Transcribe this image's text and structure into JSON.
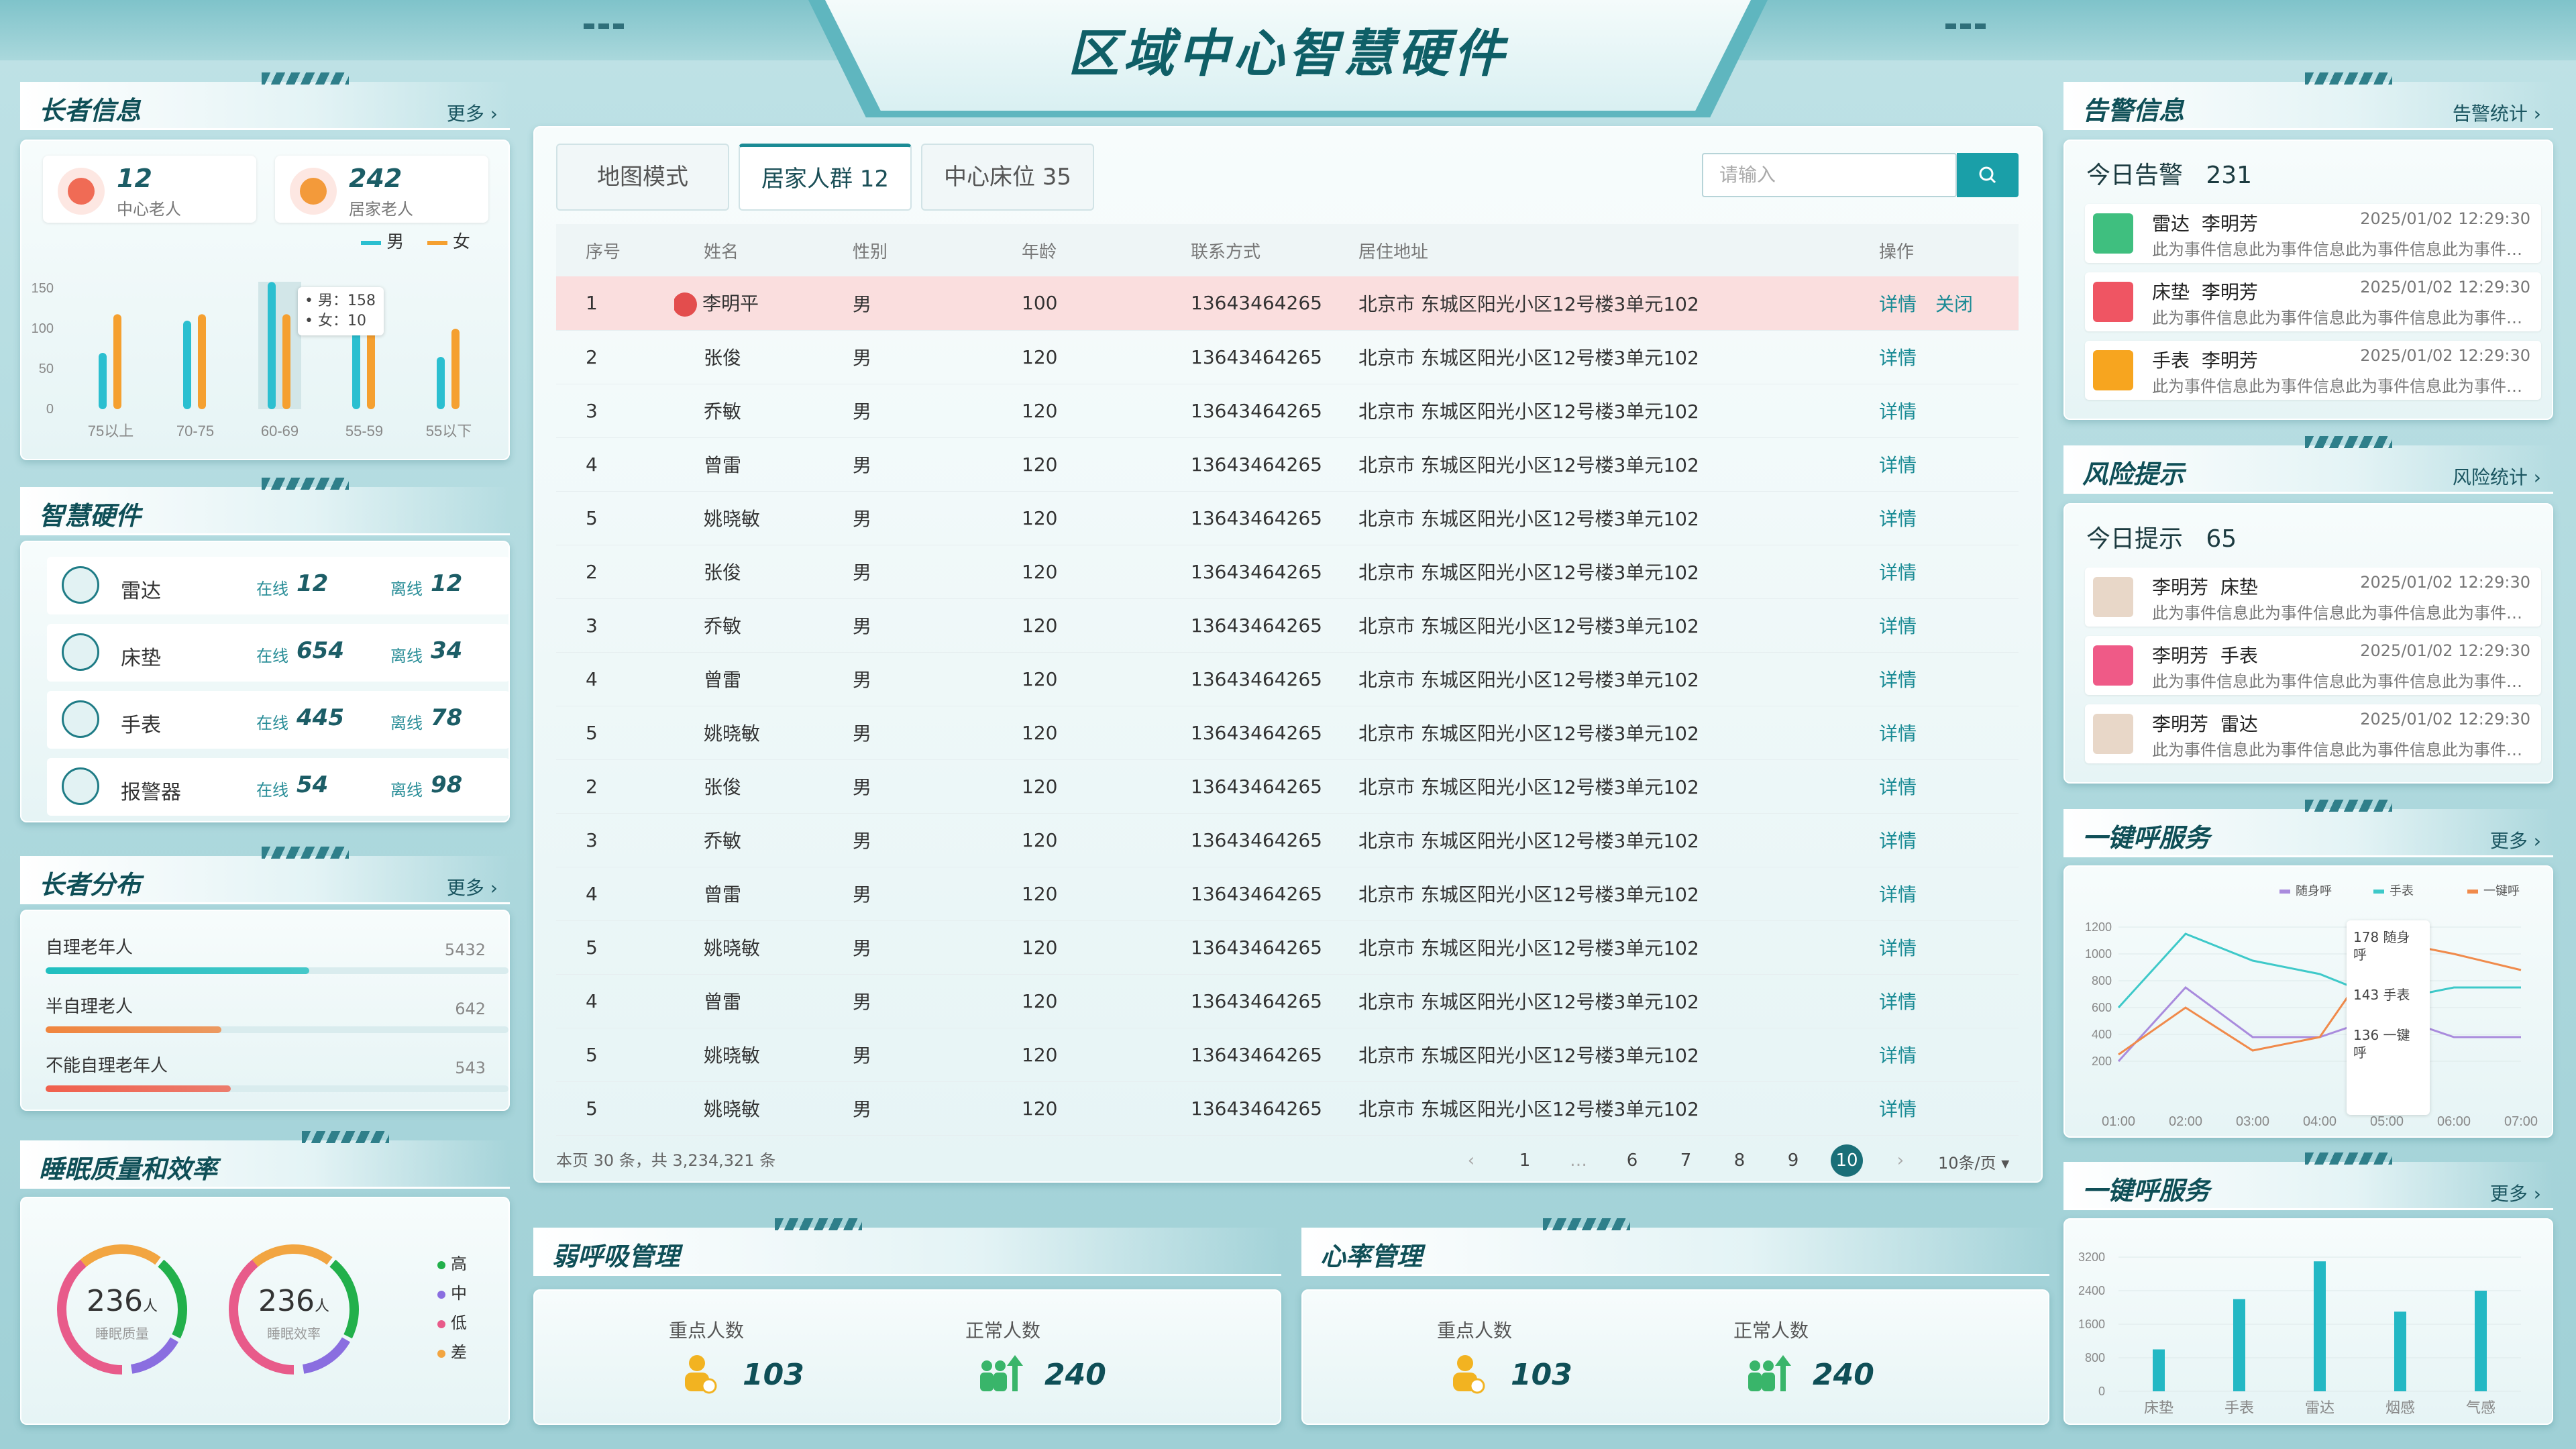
{
  "header": {
    "title": "区域中心智慧硬件"
  },
  "elder_info": {
    "title": "长者信息",
    "more": "更多 ›",
    "center_count": "12",
    "center_label": "中心老人",
    "home_count": "242",
    "home_label": "居家老人",
    "legend_male": "男",
    "legend_female": "女",
    "tooltip_male": "• 男：158",
    "tooltip_female": "• 女：10",
    "colors": {
      "male": "#2bbfd0",
      "female": "#f5a030"
    }
  },
  "chart_data": [
    {
      "type": "bar",
      "categories": [
        "75以上",
        "70-75",
        "60-69",
        "55-59",
        "55以下"
      ],
      "series": [
        {
          "name": "男",
          "values": [
            70,
            110,
            158,
            150,
            65
          ]
        },
        {
          "name": "女",
          "values": [
            118,
            118,
            118,
            118,
            100
          ]
        }
      ],
      "ylim": [
        0,
        150
      ],
      "yticks": [
        "0",
        "50",
        "100",
        "150"
      ]
    },
    {
      "type": "line",
      "x": [
        "01:00",
        "02:00",
        "03:00",
        "04:00",
        "05:00",
        "06:00",
        "07:00"
      ],
      "series": [
        {
          "name": "随身呼",
          "values": [
            200,
            750,
            380,
            380,
            550,
            380,
            380
          ]
        },
        {
          "name": "手表",
          "values": [
            600,
            1150,
            950,
            850,
            650,
            750,
            750
          ]
        },
        {
          "name": "一键呼",
          "values": [
            250,
            600,
            280,
            380,
            1100,
            1000,
            880
          ]
        }
      ],
      "ylim": [
        0,
        1200
      ],
      "yticks": [
        "200",
        "400",
        "600",
        "800",
        "1000",
        "1200"
      ],
      "tooltip": [
        "178 随身呼",
        "143 手表",
        "136 一键呼"
      ]
    },
    {
      "type": "bar",
      "categories": [
        "床垫",
        "手表",
        "雷达",
        "烟感",
        "气感"
      ],
      "values": [
        1000,
        2200,
        3100,
        1900,
        2400
      ],
      "ylim": [
        0,
        3200
      ],
      "yticks": [
        "0",
        "800",
        "1600",
        "2400",
        "3200"
      ]
    }
  ],
  "hardware": {
    "title": "智慧硬件",
    "online_label": "在线",
    "offline_label": "离线",
    "items": [
      {
        "name": "雷达",
        "online": "12",
        "offline": "12"
      },
      {
        "name": "床垫",
        "online": "654",
        "offline": "34"
      },
      {
        "name": "手表",
        "online": "445",
        "offline": "78"
      },
      {
        "name": "报警器",
        "online": "54",
        "offline": "98"
      }
    ]
  },
  "distribution": {
    "title": "长者分布",
    "more": "更多 ›",
    "items": [
      {
        "label": "自理老年人",
        "value": "5432",
        "fraction": 0.57,
        "color": "#20bfc0"
      },
      {
        "label": "半自理老人",
        "value": "642",
        "fraction": 0.38,
        "color": "#f0853e"
      },
      {
        "label": "不能自理老年人",
        "value": "543",
        "fraction": 0.4,
        "color": "#f0604d"
      }
    ]
  },
  "sleep": {
    "title": "睡眠质量和效率",
    "quality_value": "236",
    "quality_unit": "人",
    "quality_label": "睡眠质量",
    "efficiency_value": "236",
    "efficiency_unit": "人",
    "efficiency_label": "睡眠效率",
    "legend": [
      {
        "label": "高",
        "color": "#22b04b"
      },
      {
        "label": "中",
        "color": "#8a6ee0"
      },
      {
        "label": "低",
        "color": "#e85b8a"
      },
      {
        "label": "差",
        "color": "#f2a541"
      }
    ]
  },
  "main": {
    "tabs": [
      {
        "label": "地图模式"
      },
      {
        "label": "居家人群 12"
      },
      {
        "label": "中心床位 35"
      }
    ],
    "search_placeholder": "请输入",
    "columns": [
      "序号",
      "姓名",
      "性别",
      "年龄",
      "联系方式",
      "居住地址",
      "操作"
    ],
    "detail_label": "详情",
    "close_label": "关闭",
    "rows": [
      {
        "no": "1",
        "name": "李明平",
        "gender": "男",
        "age": "100",
        "phone": "13643464265",
        "addr": "北京市 东城区阳光小区12号楼3单元102"
      },
      {
        "no": "2",
        "name": "张俊",
        "gender": "男",
        "age": "120",
        "phone": "13643464265",
        "addr": "北京市 东城区阳光小区12号楼3单元102"
      },
      {
        "no": "3",
        "name": "乔敏",
        "gender": "男",
        "age": "120",
        "phone": "13643464265",
        "addr": "北京市 东城区阳光小区12号楼3单元102"
      },
      {
        "no": "4",
        "name": "曾雷",
        "gender": "男",
        "age": "120",
        "phone": "13643464265",
        "addr": "北京市 东城区阳光小区12号楼3单元102"
      },
      {
        "no": "5",
        "name": "姚晓敏",
        "gender": "男",
        "age": "120",
        "phone": "13643464265",
        "addr": "北京市 东城区阳光小区12号楼3单元102"
      },
      {
        "no": "2",
        "name": "张俊",
        "gender": "男",
        "age": "120",
        "phone": "13643464265",
        "addr": "北京市 东城区阳光小区12号楼3单元102"
      },
      {
        "no": "3",
        "name": "乔敏",
        "gender": "男",
        "age": "120",
        "phone": "13643464265",
        "addr": "北京市 东城区阳光小区12号楼3单元102"
      },
      {
        "no": "4",
        "name": "曾雷",
        "gender": "男",
        "age": "120",
        "phone": "13643464265",
        "addr": "北京市 东城区阳光小区12号楼3单元102"
      },
      {
        "no": "5",
        "name": "姚晓敏",
        "gender": "男",
        "age": "120",
        "phone": "13643464265",
        "addr": "北京市 东城区阳光小区12号楼3单元102"
      },
      {
        "no": "2",
        "name": "张俊",
        "gender": "男",
        "age": "120",
        "phone": "13643464265",
        "addr": "北京市 东城区阳光小区12号楼3单元102"
      },
      {
        "no": "3",
        "name": "乔敏",
        "gender": "男",
        "age": "120",
        "phone": "13643464265",
        "addr": "北京市 东城区阳光小区12号楼3单元102"
      },
      {
        "no": "4",
        "name": "曾雷",
        "gender": "男",
        "age": "120",
        "phone": "13643464265",
        "addr": "北京市 东城区阳光小区12号楼3单元102"
      },
      {
        "no": "5",
        "name": "姚晓敏",
        "gender": "男",
        "age": "120",
        "phone": "13643464265",
        "addr": "北京市 东城区阳光小区12号楼3单元102"
      },
      {
        "no": "4",
        "name": "曾雷",
        "gender": "男",
        "age": "120",
        "phone": "13643464265",
        "addr": "北京市 东城区阳光小区12号楼3单元102"
      },
      {
        "no": "5",
        "name": "姚晓敏",
        "gender": "男",
        "age": "120",
        "phone": "13643464265",
        "addr": "北京市 东城区阳光小区12号楼3单元102"
      },
      {
        "no": "5",
        "name": "姚晓敏",
        "gender": "男",
        "age": "120",
        "phone": "13643464265",
        "addr": "北京市 东城区阳光小区12号楼3单元102"
      }
    ],
    "pager": {
      "info": "本页 30 条，共 3,234,321 条",
      "pages": [
        "1",
        "…",
        "6",
        "7",
        "8",
        "9",
        "10"
      ],
      "current": "10",
      "prev": "‹",
      "next": "›",
      "size": "10条/页 ▾"
    }
  },
  "weak_breath": {
    "title": "弱呼吸管理",
    "key_label": "重点人数",
    "key_value": "103",
    "normal_label": "正常人数",
    "normal_value": "240"
  },
  "heart_rate": {
    "title": "心率管理",
    "key_label": "重点人数",
    "key_value": "103",
    "normal_label": "正常人数",
    "normal_value": "240"
  },
  "alarm": {
    "title": "告警信息",
    "more": "告警统计 ›",
    "today_label": "今日告警",
    "today_value": "231",
    "items": [
      {
        "device": "雷达",
        "name": "李明芳",
        "time": "2025/01/02 12:29:30",
        "desc": "此为事件信息此为事件信息此为事件信息此为事件信息",
        "color": "#3fbf7f"
      },
      {
        "device": "床垫",
        "name": "李明芳",
        "time": "2025/01/02 12:29:30",
        "desc": "此为事件信息此为事件信息此为事件信息此为事件信息",
        "color": "#ef5563"
      },
      {
        "device": "手表",
        "name": "李明芳",
        "time": "2025/01/02 12:29:30",
        "desc": "此为事件信息此为事件信息此为事件信息此为事件信息",
        "color": "#f7a51f"
      }
    ]
  },
  "risk": {
    "title": "风险提示",
    "more": "风险统计 ›",
    "today_label": "今日提示",
    "today_value": "65",
    "items": [
      {
        "name": "李明芳",
        "device": "床垫",
        "time": "2025/01/02 12:29:30",
        "desc": "此为事件信息此为事件信息此为事件信息此为事件信息"
      },
      {
        "name": "李明芳",
        "device": "手表",
        "time": "2025/01/02 12:29:30",
        "desc": "此为事件信息此为事件信息此为事件信息此为事件信息"
      },
      {
        "name": "李明芳",
        "device": "雷达",
        "time": "2025/01/02 12:29:30",
        "desc": "此为事件信息此为事件信息此为事件信息此为事件信息"
      }
    ]
  },
  "call_service": {
    "title": "一键呼服务",
    "more": "更多 ›",
    "colors": [
      "#a98bdd",
      "#3ec9c9",
      "#f08a4b"
    ]
  },
  "call_service2": {
    "title": "一键呼服务",
    "more": "更多 ›",
    "color": "#23b8c4"
  }
}
